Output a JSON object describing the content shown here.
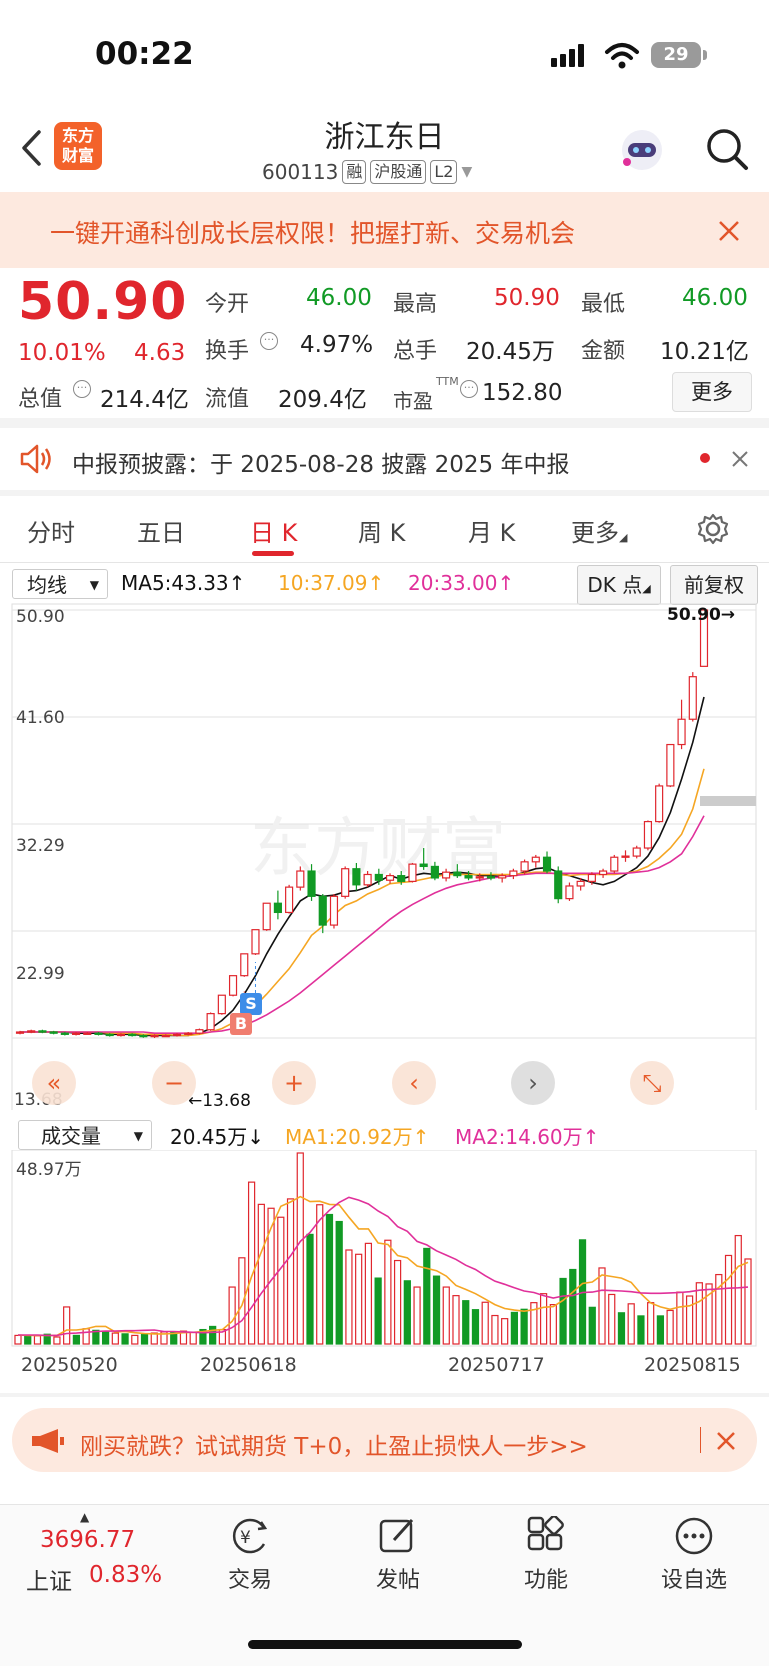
{
  "status_bar": {
    "time": "00:22",
    "battery": "29"
  },
  "header": {
    "logo_line1": "东方",
    "logo_line2": "财富",
    "title": "浙江东日",
    "code": "600113",
    "tags": [
      "融",
      "沪股通",
      "L2"
    ]
  },
  "promo_banner": {
    "text": "一键开通科创成长层权限！把握打新、交易机会"
  },
  "quote": {
    "price": "50.90",
    "change_pct": "10.01%",
    "change": "4.63",
    "open_label": "今开",
    "open": "46.00",
    "high_label": "最高",
    "high": "50.90",
    "low_label": "最低",
    "low": "46.00",
    "turnover_label": "换手",
    "turnover": "4.97%",
    "volume_label": "总手",
    "volume": "20.45万",
    "amount_label": "金额",
    "amount": "10.21亿",
    "mcap_label": "总值",
    "mcap": "214.4亿",
    "float_label": "流值",
    "float_mcap": "209.4亿",
    "pe_label": "市盈",
    "pe_sup": "TTM",
    "pe": "152.80",
    "more_label": "更多"
  },
  "notice": {
    "text": "中报预披露：于 2025-08-28 披露 2025 年中报"
  },
  "tabs": [
    "分时",
    "五日",
    "日 K",
    "周 K",
    "月 K",
    "更多"
  ],
  "active_tab": "日 K",
  "chart_header": {
    "mode": "均线",
    "ma5": "MA5:43.33",
    "ma10": "10:37.09",
    "ma20": "20:33.00",
    "dk": "DK 点",
    "adjust": "前复权"
  },
  "colors": {
    "up": "#e0262d",
    "down": "#119a25",
    "ma5": "#111111",
    "ma10": "#f5a623",
    "ma20": "#e0309a",
    "accent": "#f3622a"
  },
  "icons": [
    "back-icon",
    "robot-avatar-icon",
    "search-icon",
    "close-icon",
    "speaker-icon",
    "gear-icon",
    "megaphone-icon",
    "trade-icon",
    "post-icon",
    "function-icon",
    "watchlist-icon"
  ],
  "chart_data": [
    {
      "type": "candlestick",
      "y_ticks": [
        "50.90",
        "41.60",
        "32.29",
        "22.99",
        "13.68"
      ],
      "ylim": [
        13.68,
        50.9
      ],
      "max_marker": "50.90→",
      "min_marker": "←13.68",
      "buy_label": "B",
      "sell_label": "S",
      "candles": [
        [
          14.2,
          14.3,
          14.0,
          14.2
        ],
        [
          14.2,
          14.4,
          14.1,
          14.3
        ],
        [
          14.3,
          14.4,
          14.1,
          14.2
        ],
        [
          14.2,
          14.3,
          14.0,
          14.1
        ],
        [
          14.1,
          14.2,
          13.9,
          14.0
        ],
        [
          14.0,
          14.2,
          13.9,
          14.1
        ],
        [
          14.1,
          14.2,
          14.0,
          14.1
        ],
        [
          14.1,
          14.2,
          13.9,
          14.0
        ],
        [
          14.0,
          14.1,
          13.8,
          13.9
        ],
        [
          13.9,
          14.1,
          13.8,
          14.0
        ],
        [
          14.0,
          14.1,
          13.8,
          13.9
        ],
        [
          13.9,
          14.0,
          13.7,
          13.8
        ],
        [
          13.8,
          14.0,
          13.68,
          13.9
        ],
        [
          13.9,
          14.0,
          13.8,
          13.9
        ],
        [
          13.9,
          14.1,
          13.8,
          14.0
        ],
        [
          14.0,
          14.2,
          13.9,
          14.1
        ],
        [
          14.1,
          14.5,
          14.0,
          14.4
        ],
        [
          14.4,
          15.9,
          14.3,
          15.8
        ],
        [
          15.8,
          17.4,
          15.7,
          17.4
        ],
        [
          17.4,
          19.1,
          17.3,
          19.1
        ],
        [
          19.1,
          21.0,
          19.0,
          21.0
        ],
        [
          21.0,
          23.1,
          20.9,
          23.1
        ],
        [
          23.1,
          25.4,
          23.0,
          25.4
        ],
        [
          25.4,
          26.5,
          24.0,
          24.6
        ],
        [
          24.6,
          27.0,
          24.5,
          26.8
        ],
        [
          26.8,
          28.6,
          26.5,
          28.2
        ],
        [
          28.2,
          28.8,
          25.6,
          26.0
        ],
        [
          26.0,
          26.2,
          22.8,
          23.5
        ],
        [
          23.5,
          26.2,
          23.2,
          26.0
        ],
        [
          26.0,
          28.6,
          25.8,
          28.4
        ],
        [
          28.4,
          28.9,
          26.5,
          27.0
        ],
        [
          27.0,
          28.2,
          26.8,
          27.9
        ],
        [
          27.9,
          28.4,
          27.0,
          27.4
        ],
        [
          27.4,
          28.0,
          27.1,
          27.8
        ],
        [
          27.8,
          28.2,
          27.0,
          27.3
        ],
        [
          27.3,
          28.9,
          27.2,
          28.8
        ],
        [
          28.8,
          30.2,
          28.3,
          28.6
        ],
        [
          28.6,
          29.0,
          27.4,
          27.6
        ],
        [
          27.6,
          28.4,
          27.3,
          28.1
        ],
        [
          28.1,
          28.8,
          27.6,
          27.8
        ],
        [
          27.8,
          28.2,
          27.4,
          27.6
        ],
        [
          27.6,
          28.0,
          27.3,
          27.7
        ],
        [
          27.7,
          28.1,
          27.4,
          27.6
        ],
        [
          27.6,
          28.0,
          27.2,
          27.8
        ],
        [
          27.8,
          28.4,
          27.5,
          28.2
        ],
        [
          28.2,
          29.2,
          27.9,
          29.0
        ],
        [
          29.0,
          29.6,
          28.5,
          29.4
        ],
        [
          29.4,
          29.9,
          28.0,
          28.2
        ],
        [
          28.2,
          28.6,
          25.4,
          25.8
        ],
        [
          25.8,
          27.2,
          25.6,
          26.9
        ],
        [
          26.9,
          27.6,
          26.5,
          27.3
        ],
        [
          27.3,
          28.1,
          27.0,
          27.9
        ],
        [
          27.9,
          28.4,
          27.6,
          28.2
        ],
        [
          28.2,
          29.6,
          28.0,
          29.4
        ],
        [
          29.4,
          30.0,
          29.0,
          29.5
        ],
        [
          29.5,
          30.4,
          29.3,
          30.2
        ],
        [
          30.2,
          32.6,
          30.0,
          32.5
        ],
        [
          32.5,
          35.8,
          32.4,
          35.6
        ],
        [
          35.6,
          39.2,
          35.5,
          39.2
        ],
        [
          39.2,
          43.1,
          38.8,
          41.4
        ],
        [
          41.4,
          45.5,
          41.2,
          45.1
        ],
        [
          46.0,
          50.9,
          46.0,
          50.9
        ]
      ],
      "ma5": [
        14.2,
        14.2,
        14.2,
        14.2,
        14.2,
        14.1,
        14.1,
        14.1,
        14.0,
        14.0,
        14.0,
        13.9,
        13.9,
        13.9,
        13.9,
        13.9,
        14.1,
        14.5,
        15.2,
        16.1,
        17.5,
        19.1,
        21.0,
        22.7,
        24.2,
        25.6,
        26.2,
        26.0,
        26.1,
        26.4,
        26.5,
        26.8,
        27.3,
        27.8,
        27.5,
        27.8,
        28.0,
        27.9,
        28.0,
        28.1,
        28.0,
        27.8,
        27.8,
        27.7,
        27.8,
        28.1,
        28.4,
        28.5,
        28.1,
        27.8,
        27.5,
        27.2,
        27.0,
        27.3,
        27.9,
        28.5,
        29.5,
        31.1,
        33.3,
        36.2,
        39.4,
        43.33
      ],
      "ma10": [
        14.2,
        14.2,
        14.2,
        14.2,
        14.2,
        14.2,
        14.2,
        14.2,
        14.1,
        14.1,
        14.1,
        14.0,
        14.0,
        14.0,
        13.9,
        13.9,
        14.0,
        14.2,
        14.5,
        15.0,
        15.7,
        16.5,
        17.5,
        18.6,
        19.7,
        21.1,
        22.6,
        23.4,
        24.4,
        25.2,
        25.6,
        26.2,
        26.6,
        27.1,
        27.2,
        27.3,
        27.5,
        27.7,
        27.9,
        27.9,
        27.9,
        27.9,
        27.9,
        27.9,
        27.9,
        28.0,
        28.1,
        28.1,
        27.9,
        27.8,
        27.9,
        27.9,
        27.9,
        27.9,
        28.0,
        28.2,
        28.6,
        29.3,
        30.2,
        31.4,
        33.6,
        37.09
      ],
      "ma20": [
        14.2,
        14.2,
        14.2,
        14.2,
        14.2,
        14.2,
        14.2,
        14.2,
        14.2,
        14.2,
        14.2,
        14.2,
        14.1,
        14.1,
        14.1,
        14.1,
        14.1,
        14.2,
        14.3,
        14.5,
        14.8,
        15.2,
        15.7,
        16.3,
        16.9,
        17.6,
        18.4,
        19.2,
        20.0,
        20.8,
        21.6,
        22.4,
        23.2,
        24.0,
        24.7,
        25.3,
        25.8,
        26.3,
        26.7,
        27.0,
        27.2,
        27.4,
        27.6,
        27.7,
        27.8,
        27.9,
        28.0,
        28.0,
        28.0,
        28.0,
        28.0,
        28.0,
        28.0,
        28.0,
        28.0,
        28.1,
        28.2,
        28.5,
        29.0,
        29.7,
        31.2,
        33.0
      ]
    },
    {
      "type": "bar",
      "title": "成交量",
      "current": "20.45万",
      "ma1": "MA1:20.92万",
      "ma2": "MA2:14.60万",
      "ymax_label": "48.97万",
      "ylim": [
        0,
        48.97
      ],
      "x_ticks": [
        "20250520",
        "20250618",
        "20250717",
        "20250815"
      ],
      "values": [
        2.2,
        2.0,
        2.1,
        2.5,
        1.8,
        9.5,
        2.2,
        3.9,
        3.5,
        3.2,
        2.8,
        2.6,
        2.2,
        2.4,
        2.8,
        3.1,
        2.9,
        3.3,
        3.0,
        3.7,
        4.5,
        3.7,
        14.6,
        22.1,
        41.5,
        35.8,
        34.8,
        32.5,
        37.2,
        48.97,
        28.1,
        35.7,
        33.2,
        31.4,
        24.1,
        23.0,
        25.8,
        16.9,
        26.6,
        21.4,
        16.2,
        14.6,
        24.5,
        17.4,
        14.6,
        12.4,
        11.1,
        8.8,
        10.7,
        7.3,
        6.5,
        8.1,
        8.9,
        10.6,
        12.9,
        10.1,
        16.8,
        19.1,
        26.7,
        9.4,
        19.5,
        12.7,
        8.0,
        10.3,
        7.2,
        10.6,
        7.2,
        8.6,
        13.3,
        12.3,
        15.7,
        15.4,
        17.8,
        22.7,
        27.8,
        21.8
      ],
      "up": [
        1,
        0,
        1,
        0,
        1,
        1,
        0,
        1,
        0,
        0,
        1,
        0,
        1,
        0,
        1,
        1,
        0,
        1,
        1,
        0,
        0,
        1,
        1,
        1,
        1,
        1,
        1,
        1,
        1,
        1,
        0,
        1,
        0,
        0,
        1,
        1,
        1,
        0,
        1,
        1,
        0,
        1,
        0,
        0,
        1,
        1,
        0,
        0,
        1,
        1,
        1,
        0,
        0,
        1,
        1,
        1,
        0,
        0,
        0,
        0,
        1,
        1,
        0,
        1,
        0,
        1,
        0,
        1,
        1,
        1,
        1,
        1,
        1,
        1,
        1,
        1
      ],
      "ma1_series": [
        2.3,
        2.2,
        2.2,
        2.2,
        2.2,
        3.6,
        3.6,
        3.9,
        4.5,
        4.5,
        3.1,
        3.2,
        2.9,
        2.7,
        2.6,
        2.6,
        2.7,
        2.9,
        3.0,
        3.2,
        3.5,
        3.7,
        5.8,
        9.9,
        17.3,
        23.6,
        29.8,
        35.3,
        36.4,
        37.8,
        36.5,
        36.6,
        35.8,
        35.7,
        32.5,
        29.5,
        29.5,
        25.9,
        25.5,
        22.7,
        22.1,
        20.0,
        19.4,
        18.8,
        17.4,
        15.0,
        14.0,
        12.9,
        11.5,
        10.1,
        9.1,
        8.7,
        8.4,
        8.8,
        9.4,
        9.6,
        11.2,
        13.3,
        15.5,
        15.9,
        17.7,
        17.3,
        16.9,
        15.8,
        12.9,
        10.5,
        9.5,
        8.9,
        9.5,
        9.8,
        10.9,
        12.7,
        14.5,
        16.8,
        19.9,
        20.92
      ],
      "ma2_series": [
        2.3,
        2.3,
        2.3,
        2.2,
        2.2,
        2.7,
        2.8,
        3.0,
        3.2,
        3.3,
        3.3,
        3.4,
        3.4,
        3.5,
        3.6,
        3.2,
        3.2,
        3.1,
        3.0,
        2.9,
        3.0,
        3.1,
        4.2,
        6.0,
        9.4,
        13.0,
        16.3,
        19.4,
        22.6,
        26.3,
        28.6,
        31.8,
        34.3,
        36.3,
        37.6,
        36.9,
        35.9,
        34.1,
        32.7,
        30.1,
        28.9,
        26.3,
        25.4,
        23.9,
        22.8,
        21.7,
        20.2,
        19.1,
        17.5,
        16.1,
        15.3,
        14.4,
        13.6,
        13.2,
        12.4,
        11.8,
        12.3,
        12.4,
        13.2,
        13.3,
        13.8,
        13.7,
        13.6,
        13.4,
        13.1,
        13.0,
        13.0,
        13.1,
        13.2,
        13.4,
        13.8,
        14.0,
        14.1,
        14.3,
        14.4,
        14.6
      ]
    }
  ],
  "chart_controls": [
    "«",
    "−",
    "+",
    "‹",
    "›",
    "⤡"
  ],
  "ad_banner": {
    "text": "刚买就跌？试试期货 T+0，止盈止损快人一步>>"
  },
  "bottom_nav": {
    "index_value": "3696.77",
    "index_name": "上证",
    "index_change": "0.83%",
    "items": [
      "交易",
      "发帖",
      "功能",
      "设自选"
    ]
  }
}
